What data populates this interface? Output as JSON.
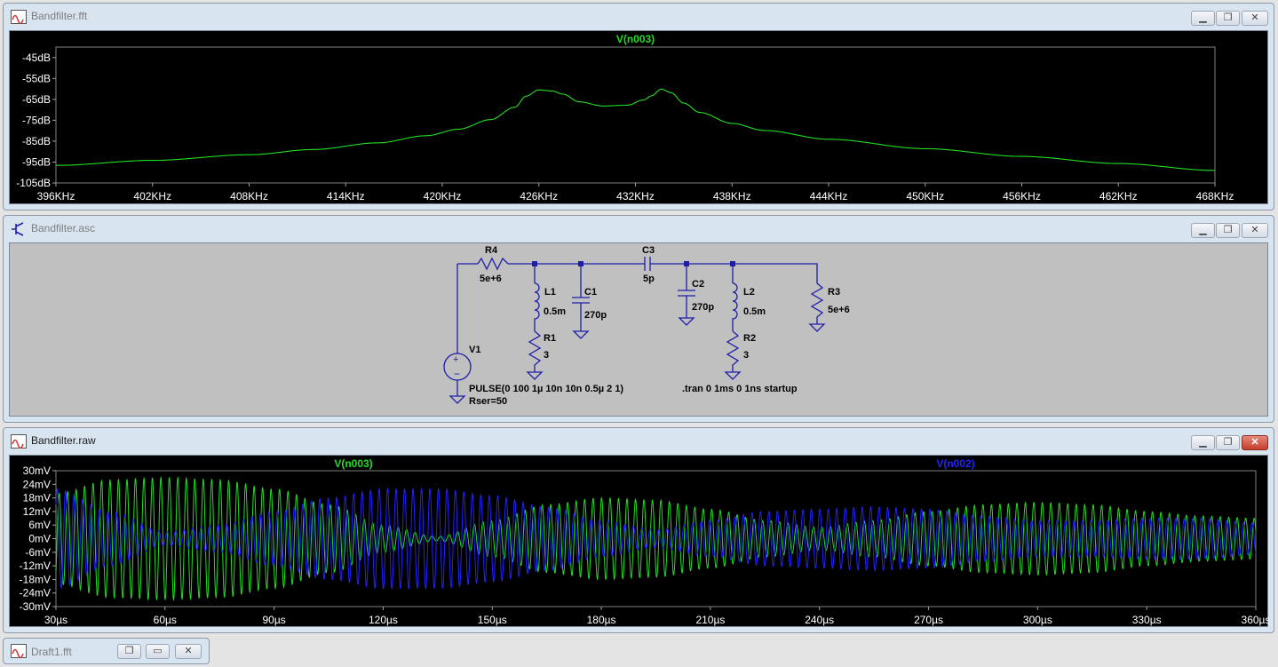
{
  "windows": {
    "fft": {
      "title": "Bandfilter.fft"
    },
    "schematic": {
      "title": "Bandfilter.asc"
    },
    "raw": {
      "title": "Bandfilter.raw"
    },
    "draft": {
      "title": "Draft1.fft"
    }
  },
  "controls": {
    "minimize": "▁",
    "restore": "❐",
    "close": "✕"
  },
  "colors": {
    "trace_green": "#22dd22",
    "trace_blue": "#2222ff",
    "plot_bg": "#000000",
    "axis_text": "#ffffff",
    "schematic_bg": "#c0c0c0",
    "schematic_wire": "#1e1ea8"
  },
  "icons": {
    "waveform": "waveform-icon",
    "schematic": "transistor-icon"
  },
  "schematic": {
    "r4_name": "R4",
    "r4_value": "5e+6",
    "l1_name": "L1",
    "l1_value": "0.5m",
    "c1_name": "C1",
    "c1_value": "270p",
    "r1_name": "R1",
    "r1_value": "3",
    "c3_name": "C3",
    "c3_value": "5p",
    "c2_name": "C2",
    "c2_value": "270p",
    "l2_name": "L2",
    "l2_value": "0.5m",
    "r2_name": "R2",
    "r2_value": "3",
    "r3_name": "R3",
    "r3_value": "5e+6",
    "v1_name": "V1",
    "v1_value": "PULSE(0 100 1µ 10n 10n 0.5µ 2 1)",
    "v1_rser": "Rser=50",
    "directive": ".tran 0 1ms 0 1ns startup"
  },
  "chart_data": [
    {
      "type": "line",
      "title": "V(n003)",
      "x_ticks": [
        "396KHz",
        "402KHz",
        "408KHz",
        "414KHz",
        "420KHz",
        "426KHz",
        "432KHz",
        "438KHz",
        "444KHz",
        "450KHz",
        "456KHz",
        "462KHz",
        "468KHz"
      ],
      "y_ticks": [
        "-45dB",
        "-55dB",
        "-65dB",
        "-75dB",
        "-85dB",
        "-95dB",
        "-105dB"
      ],
      "xlim": [
        396,
        468
      ],
      "ylim": [
        -105,
        -40
      ],
      "series": [
        {
          "name": "V(n003)",
          "color": "#22dd22",
          "x": [
            396,
            402,
            408,
            412,
            416,
            419,
            421,
            423,
            424.5,
            425.2,
            426,
            426.8,
            427.5,
            428.5,
            430,
            431.5,
            432.5,
            433,
            433.6,
            434.2,
            435,
            436,
            438,
            440,
            444,
            450,
            456,
            462,
            468
          ],
          "y": [
            -96.6,
            -94.2,
            -91.5,
            -89,
            -85.8,
            -82.4,
            -79.3,
            -74.7,
            -68.8,
            -63.5,
            -60.5,
            -61,
            -62.5,
            -66.2,
            -68.2,
            -67.8,
            -65.3,
            -63.3,
            -60.1,
            -61.8,
            -66.8,
            -71.3,
            -76.5,
            -79.9,
            -84.1,
            -88.6,
            -92.3,
            -95.7,
            -99
          ]
        }
      ]
    },
    {
      "type": "line",
      "title": "V(n003) / V(n002)",
      "x_ticks": [
        "30µs",
        "60µs",
        "90µs",
        "120µs",
        "150µs",
        "180µs",
        "210µs",
        "240µs",
        "270µs",
        "300µs",
        "330µs",
        "360µs"
      ],
      "y_ticks": [
        "30mV",
        "24mV",
        "18mV",
        "12mV",
        "6mV",
        "0mV",
        "-6mV",
        "-12mV",
        "-18mV",
        "-24mV",
        "-30mV"
      ],
      "xlim": [
        30,
        360
      ],
      "ylim": [
        -30,
        30
      ],
      "carrier_frequency_khz": 429,
      "series": [
        {
          "name": "V(n003)",
          "color": "#22dd22",
          "envelope_x": [
            30,
            45,
            60,
            75,
            90,
            105,
            120,
            135,
            150,
            165,
            180,
            195,
            210,
            225,
            240,
            255,
            270,
            285,
            300,
            315,
            330,
            345,
            360
          ],
          "envelope_amplitude": [
            20,
            26,
            27,
            26,
            22,
            15,
            6,
            1,
            8,
            15,
            18,
            17,
            13,
            8,
            5,
            8,
            12,
            15,
            16,
            15,
            12,
            10,
            9
          ]
        },
        {
          "name": "V(n002)",
          "color": "#2222ff",
          "envelope_x": [
            30,
            45,
            60,
            75,
            90,
            105,
            120,
            135,
            150,
            165,
            180,
            195,
            210,
            225,
            240,
            255,
            270,
            285,
            300,
            315,
            330,
            345,
            360
          ],
          "envelope_amplitude": [
            22,
            12,
            3,
            6,
            12,
            18,
            22,
            22,
            19,
            14,
            8,
            4,
            8,
            12,
            13,
            14,
            13,
            10,
            8,
            8,
            9,
            9,
            7
          ]
        }
      ]
    }
  ]
}
